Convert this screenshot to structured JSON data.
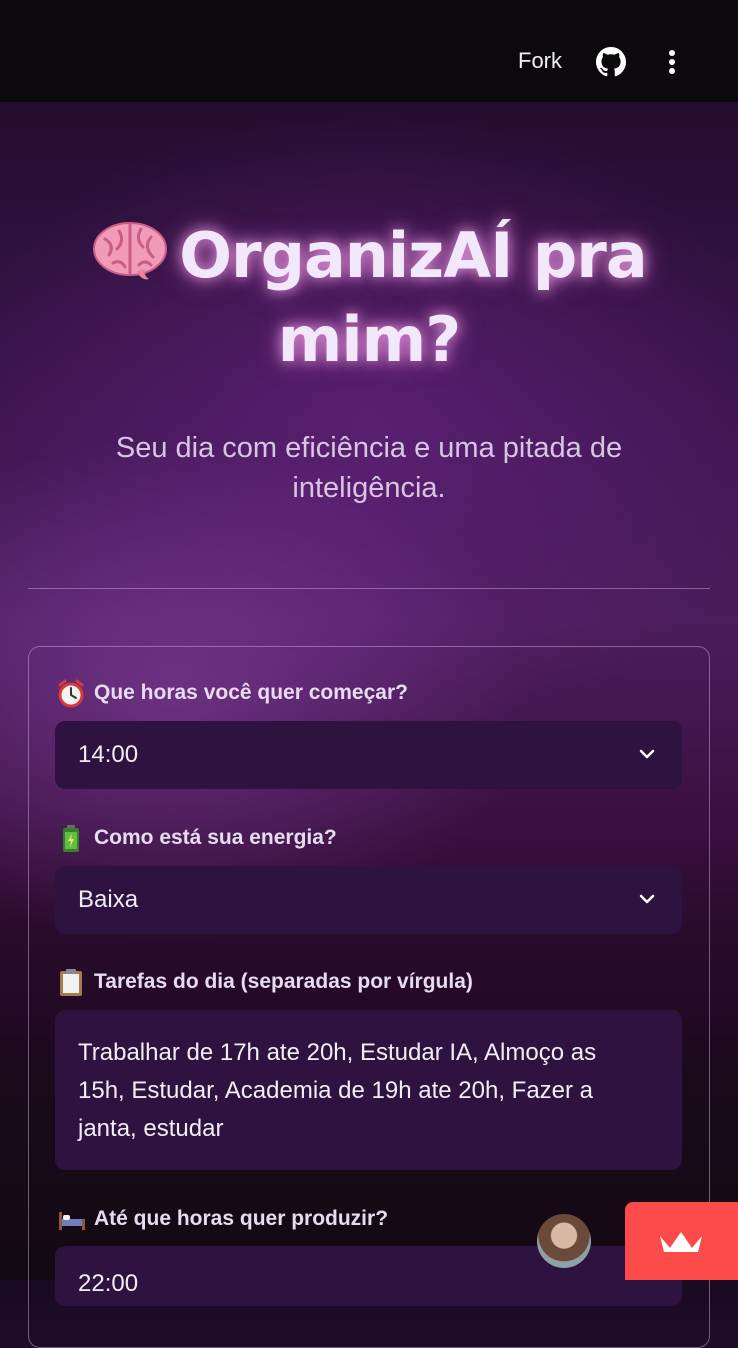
{
  "topbar": {
    "fork_label": "Fork"
  },
  "header": {
    "title": "OrganizAÍ pra mim?",
    "subtitle": "Seu dia com eficiência e uma pitada de inteligência."
  },
  "form": {
    "start_time": {
      "label": "Que horas você quer começar?",
      "value": "14:00",
      "icon": "alarm-clock-icon"
    },
    "energy": {
      "label": "Como está sua energia?",
      "value": "Baixa",
      "icon": "battery-icon"
    },
    "tasks": {
      "label": "Tarefas do dia (separadas por vírgula)",
      "value": "Trabalhar de 17h ate 20h, Estudar IA, Almoço as 15h, Estudar, Academia de 19h ate 20h, Fazer a janta, estudar",
      "icon": "clipboard-icon"
    },
    "end_time": {
      "label": "Até que horas quer produzir?",
      "value": "22:00",
      "icon": "bed-icon"
    }
  },
  "colors": {
    "accent_badge": "#fd4b4b",
    "field_bg": "#2e1240"
  }
}
